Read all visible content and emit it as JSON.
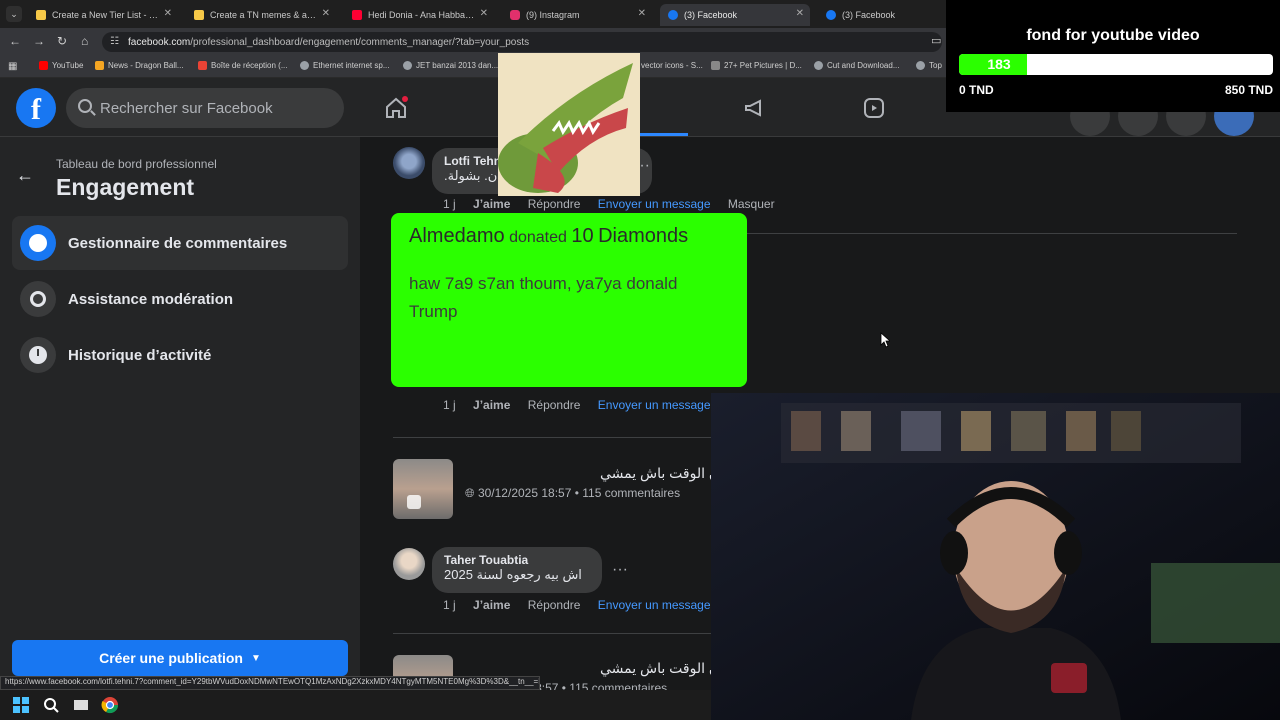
{
  "browser": {
    "tabs": [
      {
        "title": "Create a New Tier List - TierMa",
        "color": "#f7c948",
        "active": false
      },
      {
        "title": "Create a TN memes & actu 202",
        "color": "#f7c948",
        "active": false
      },
      {
        "title": "Hedi Donia - Ana Habbaytou |",
        "color": "#ff0033",
        "active": false
      },
      {
        "title": "(9) Instagram",
        "color": "#e1306c",
        "active": false
      },
      {
        "title": "(3) Facebook",
        "color": "#1877f2",
        "active": true
      },
      {
        "title": "(3) Facebook",
        "color": "#1877f2",
        "active": false
      }
    ],
    "url_host": "facebook.com",
    "url_path": "/professional_dashboard/engagement/comments_manager/?tab=your_posts",
    "bookmarks": [
      {
        "label": "YouTube",
        "color": "#ff0000"
      },
      {
        "label": "News - Dragon Ball...",
        "color": "#f5a623"
      },
      {
        "label": "Boîte de réception (...",
        "color": "#ea4335"
      },
      {
        "label": "Ethernet internet sp...",
        "color": "#9aa0a6"
      },
      {
        "label": "JET banzai 2013 dan...",
        "color": "#9aa0a6"
      },
      {
        "label": "vector icons - S...",
        "color": "#9aa0a6"
      },
      {
        "label": "27+ Pet Pictures | D...",
        "color": "#9aa0a6"
      },
      {
        "label": "Cut and Download...",
        "color": "#9aa0a6"
      },
      {
        "label": "Top",
        "color": "#9aa0a6"
      }
    ],
    "status_url": "https://www.facebook.com/lotfi.tehni.7?comment_id=Y29tbWVudDoxNDMwNTEwOTQ1MzAxNDg2XzkxMDY4NTgyMTM5NTE0Mg%3D%3D&__tn__=R"
  },
  "header": {
    "search_placeholder": "Rechercher sur Facebook"
  },
  "sidebar": {
    "dashboard_label": "Tableau de bord professionnel",
    "title": "Engagement",
    "items": [
      {
        "label": "Gestionnaire de commentaires"
      },
      {
        "label": "Assistance modération"
      },
      {
        "label": "Historique d’activité"
      }
    ],
    "create_button": "Créer une publication"
  },
  "comments": [
    {
      "author": "Lotfi Tehni",
      "text": "ن. بشولة.",
      "time": "1 j",
      "like": "J’aime",
      "reply": "Répondre",
      "message": "Envoyer un message",
      "hide": "Masquer"
    },
    {
      "time": "1 j",
      "like": "J’aime",
      "reply": "Répondre",
      "message": "Envoyer un message"
    },
    {
      "author": "Taher Touabtia",
      "text": "اش بيه رجعوه لسنة 2025",
      "time": "1 j",
      "like": "J’aime",
      "reply": "Répondre",
      "message": "Envoyer un message"
    }
  ],
  "posts": [
    {
      "title": "ن الوقت باش يمشي",
      "date": "30/12/2025 18:57",
      "count": "115 commentaires"
    },
    {
      "title": "ن الوقت باش يمشي",
      "date": "30/12/2025 18:57",
      "count": "115 commentaires"
    }
  ],
  "donation": {
    "name": "Almedamo",
    "verb": "donated",
    "amount": "10",
    "currency": "Diamonds",
    "message": "haw 7a9 s7an thoum, ya7ya donald Trump"
  },
  "goal": {
    "title": "fond for youtube video",
    "current": "183",
    "min_label": "0 TND",
    "max_label": "850 TND",
    "progress_fraction": 0.215,
    "fill_color": "#2bff00"
  }
}
